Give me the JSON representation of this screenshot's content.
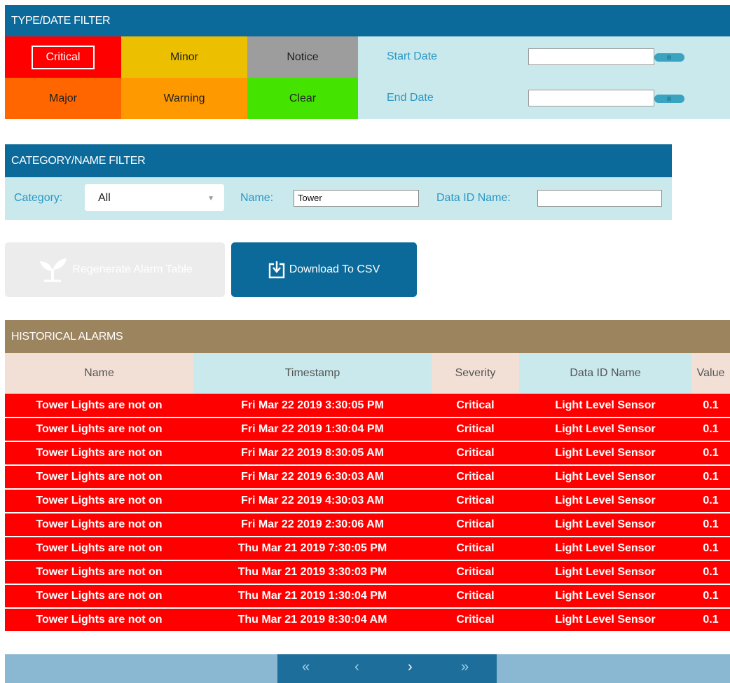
{
  "type_filter": {
    "title": "TYPE/DATE FILTER",
    "severities": {
      "critical": "Critical",
      "minor": "Minor",
      "notice": "Notice",
      "major": "Major",
      "warning": "Warning",
      "clear": "Clear"
    },
    "start_date_label": "Start Date",
    "end_date_label": "End Date",
    "start_date_value": "",
    "end_date_value": ""
  },
  "category_filter": {
    "title": "CATEGORY/NAME FILTER",
    "category_label": "Category:",
    "category_value": "All",
    "name_label": "Name:",
    "name_value": "Tower",
    "data_id_label": "Data ID Name:",
    "data_id_value": ""
  },
  "actions": {
    "regenerate_label": "Regenerate Alarm Table",
    "download_label": "Download To CSV"
  },
  "historical": {
    "title": "HISTORICAL ALARMS",
    "columns": [
      "Name",
      "Timestamp",
      "Severity",
      "Data ID Name",
      "Value"
    ],
    "rows": [
      [
        "Tower Lights are not on",
        "Fri Mar 22 2019 3:30:05 PM",
        "Critical",
        "Light Level Sensor",
        "0.1"
      ],
      [
        "Tower Lights are not on",
        "Fri Mar 22 2019 1:30:04 PM",
        "Critical",
        "Light Level Sensor",
        "0.1"
      ],
      [
        "Tower Lights are not on",
        "Fri Mar 22 2019 8:30:05 AM",
        "Critical",
        "Light Level Sensor",
        "0.1"
      ],
      [
        "Tower Lights are not on",
        "Fri Mar 22 2019 6:30:03 AM",
        "Critical",
        "Light Level Sensor",
        "0.1"
      ],
      [
        "Tower Lights are not on",
        "Fri Mar 22 2019 4:30:03 AM",
        "Critical",
        "Light Level Sensor",
        "0.1"
      ],
      [
        "Tower Lights are not on",
        "Fri Mar 22 2019 2:30:06 AM",
        "Critical",
        "Light Level Sensor",
        "0.1"
      ],
      [
        "Tower Lights are not on",
        "Thu Mar 21 2019 7:30:05 PM",
        "Critical",
        "Light Level Sensor",
        "0.1"
      ],
      [
        "Tower Lights are not on",
        "Thu Mar 21 2019 3:30:03 PM",
        "Critical",
        "Light Level Sensor",
        "0.1"
      ],
      [
        "Tower Lights are not on",
        "Thu Mar 21 2019 1:30:04 PM",
        "Critical",
        "Light Level Sensor",
        "0.1"
      ],
      [
        "Tower Lights are not on",
        "Thu Mar 21 2019 8:30:04 AM",
        "Critical",
        "Light Level Sensor",
        "0.1"
      ]
    ],
    "pager": {
      "first": "«",
      "prev": "‹",
      "next": "›",
      "last": "»"
    }
  },
  "colors": {
    "header_blue": "#0b6a9a",
    "critical": "#ff0000",
    "minor": "#ecc000",
    "notice": "#9d9d9d",
    "major": "#ff6600",
    "warning": "#ff9900",
    "clear": "#44e400",
    "light_cyan": "#c9e9ec",
    "hist_header": "#9b845e"
  },
  "icons": {
    "regenerate": "plant-sprout-icon",
    "download": "download-box-icon",
    "date_picker": "calendar-toggle-icon"
  }
}
